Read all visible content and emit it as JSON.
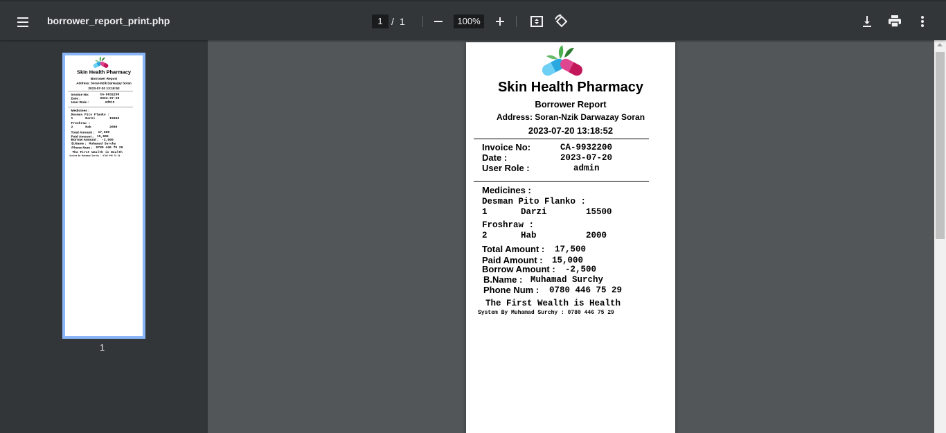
{
  "toolbar": {
    "file_name": "borrower_report_print.php",
    "current_page": "1",
    "page_separator": "/",
    "total_pages": "1",
    "zoom": "100%",
    "icons": [
      "menu-icon",
      "zoom-out-icon",
      "zoom-in-icon",
      "fit-page-icon",
      "rotate-icon",
      "download-icon",
      "print-icon",
      "more-icon"
    ]
  },
  "sidebar": {
    "thumbnail_page_number": "1"
  },
  "receipt": {
    "pharmacy_name": "Skin Health Pharmacy",
    "report_title": "Borrower Report",
    "address": "Address: Soran-Nzik Darwazay Soran",
    "datetime": "2023-07-20 13:18:52",
    "invoice_label": "Invoice No:",
    "invoice_value": "CA-9932200",
    "date_label": "Date :",
    "date_value": "2023-07-20",
    "role_label": "User Role :",
    "role_value": "admin",
    "medicines_label": "Medicines :",
    "medicines": [
      {
        "name": "Desman Pito Flanko :",
        "qty": "1",
        "unit": "Darzi",
        "price": "15500"
      },
      {
        "name": "Froshraw :",
        "qty": "2",
        "unit": "Hab",
        "price": "2000"
      }
    ],
    "total_label": "Total Amount :",
    "total_value": "17,500",
    "paid_label": "Paid Amount :",
    "paid_value": "15,000",
    "borrow_label": "Borrow Amount :",
    "borrow_value": "-2,500",
    "bname_label": "B.Name :",
    "bname_value": "Muhamad Surchy",
    "phone_label": "Phone Num :",
    "phone_value": "0780 446 75 29",
    "slogan": "The First Wealth is Health",
    "signature": "System By Muhamad Surchy : 0780 446 75 29"
  },
  "colors": {
    "toolbar_bg": "#323639",
    "viewer_bg": "#525659",
    "thumb_border": "#8ab4f8",
    "capsule_blue": "#2aa8e0",
    "capsule_pink": "#e0458f",
    "leaf_green": "#4caf50"
  }
}
